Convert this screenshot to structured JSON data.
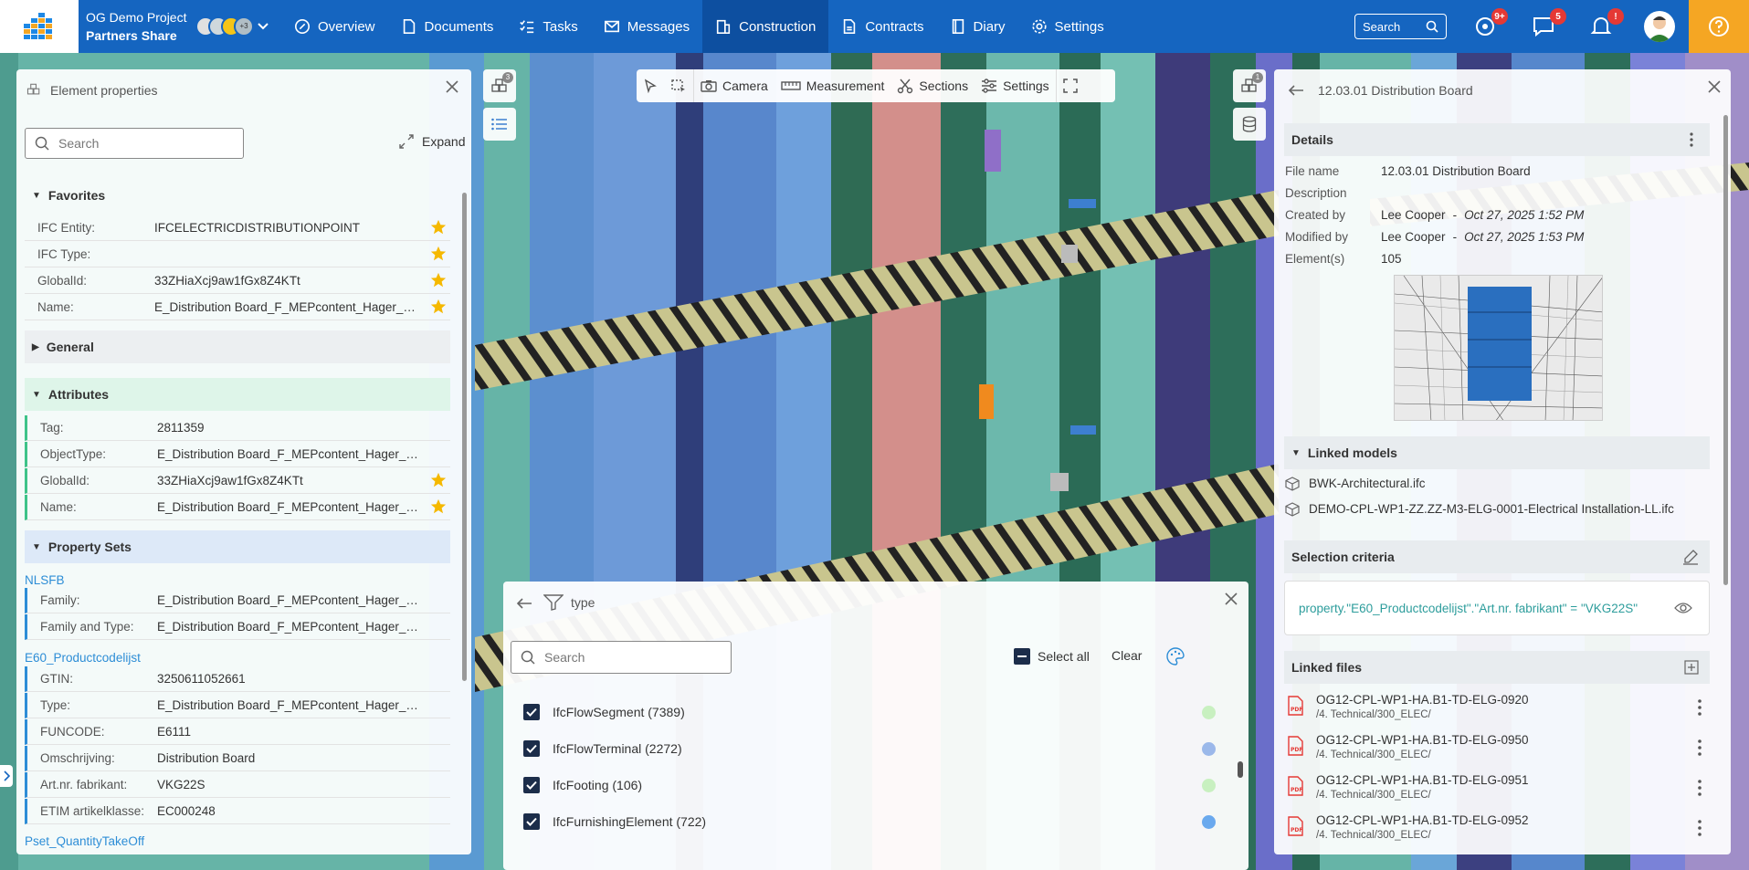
{
  "app": {
    "project_name": "OG Demo Project",
    "company": "Partners Share",
    "avatar_extra": "+3"
  },
  "nav": [
    {
      "label": "Overview",
      "icon": "overview-icon"
    },
    {
      "label": "Documents",
      "icon": "document-icon"
    },
    {
      "label": "Tasks",
      "icon": "tasks-icon"
    },
    {
      "label": "Messages",
      "icon": "mail-icon"
    },
    {
      "label": "Construction",
      "icon": "building-icon",
      "active": true
    },
    {
      "label": "Contracts",
      "icon": "contract-icon"
    },
    {
      "label": "Diary",
      "icon": "diary-icon"
    },
    {
      "label": "Settings",
      "icon": "gear-icon"
    }
  ],
  "topright": {
    "search_label": "Search",
    "badge_activity": "9+",
    "badge_chat": "5",
    "badge_alert": "!",
    "colors": {
      "brand": "#1565c0",
      "help": "#f5a623",
      "badge": "#e53935"
    }
  },
  "toolbar": {
    "camera": "Camera",
    "measurement": "Measurement",
    "sections": "Sections",
    "settings": "Settings",
    "models_count": "3",
    "right_models_count": "1"
  },
  "left_panel": {
    "title": "Element properties",
    "search_placeholder": "Search",
    "expand_label": "Expand",
    "favorites": {
      "title": "Favorites",
      "rows": [
        {
          "key": "IFC Entity:",
          "value": "IFCELECTRICDISTRIBUTIONPOINT"
        },
        {
          "key": "IFC Type:",
          "value": ""
        },
        {
          "key": "GlobalId:",
          "value": "33ZHiaXcj9aw1fGx8Z4KTt"
        },
        {
          "key": "Name:",
          "value": "E_Distribution Board_F_MEPcontent_Hager_…"
        }
      ]
    },
    "general": {
      "title": "General"
    },
    "attributes": {
      "title": "Attributes",
      "rows": [
        {
          "key": "Tag:",
          "value": "2811359"
        },
        {
          "key": "ObjectType:",
          "value": "E_Distribution Board_F_MEPcontent_Hager_…"
        },
        {
          "key": "GlobalId:",
          "value": "33ZHiaXcj9aw1fGx8Z4KTt"
        },
        {
          "key": "Name:",
          "value": "E_Distribution Board_F_MEPcontent_Hager_…"
        }
      ]
    },
    "property_sets": {
      "title": "Property Sets",
      "nlsfb": {
        "title": "NLSFB",
        "rows": [
          {
            "key": "Family:",
            "value": "E_Distribution Board_F_MEPcontent_Hager_…"
          },
          {
            "key": "Family and Type:",
            "value": "E_Distribution Board_F_MEPcontent_Hager_…"
          }
        ]
      },
      "e60": {
        "title": "E60_Productcodelijst",
        "rows": [
          {
            "key": "GTIN:",
            "value": "3250611052661"
          },
          {
            "key": "Type:",
            "value": "E_Distribution Board_F_MEPcontent_Hager_…"
          },
          {
            "key": "FUNCODE:",
            "value": "E6111"
          },
          {
            "key": "Omschrijving:",
            "value": "Distribution Board"
          },
          {
            "key": "Art.nr. fabrikant:",
            "value": "VKG22S"
          },
          {
            "key": "ETIM artikelklasse:",
            "value": "EC000248"
          }
        ]
      },
      "pset_qto": {
        "title": "Pset_QuantityTakeOff"
      }
    }
  },
  "right_panel": {
    "title": "12.03.01 Distribution Board",
    "details": {
      "title": "Details",
      "file_name_label": "File name",
      "file_name": "12.03.01 Distribution Board",
      "description_label": "Description",
      "created_by_label": "Created by",
      "created_by": "Lee Cooper",
      "created_at": "Oct 27, 2025 1:52 PM",
      "modified_by_label": "Modified by",
      "modified_by": "Lee Cooper",
      "modified_at": "Oct 27, 2025 1:53 PM",
      "elements_label": "Element(s)",
      "elements": "105",
      "separator": "-"
    },
    "linked_models": {
      "title": "Linked models",
      "items": [
        "BWK-Architectural.ifc",
        "DEMO-CPL-WP1-ZZ.ZZ-M3-ELG-0001-Electrical Installation-LL.ifc"
      ]
    },
    "selection_criteria": {
      "title": "Selection criteria",
      "text": "property.\"E60_Productcodelijst\".\"Art.nr. fabrikant\" = \"VKG22S\""
    },
    "linked_files": {
      "title": "Linked files",
      "items": [
        {
          "name": "OG12-CPL-WP1-HA.B1-TD-ELG-0920",
          "path": "/4. Technical/300_ELEC/"
        },
        {
          "name": "OG12-CPL-WP1-HA.B1-TD-ELG-0950",
          "path": "/4. Technical/300_ELEC/"
        },
        {
          "name": "OG12-CPL-WP1-HA.B1-TD-ELG-0951",
          "path": "/4. Technical/300_ELEC/"
        },
        {
          "name": "OG12-CPL-WP1-HA.B1-TD-ELG-0952",
          "path": "/4. Technical/300_ELEC/"
        }
      ]
    }
  },
  "filter_panel": {
    "title": "type",
    "search_placeholder": "Search",
    "select_all": "Select all",
    "clear": "Clear",
    "items": [
      {
        "label": "IfcFlowSegment (7389)",
        "checked": true,
        "color": "#c8f0c0"
      },
      {
        "label": "IfcFlowTerminal (2272)",
        "checked": true,
        "color": "#9bb8ea"
      },
      {
        "label": "IfcFooting (106)",
        "checked": true,
        "color": "#c8f0c0"
      },
      {
        "label": "IfcFurnishingElement (722)",
        "checked": true,
        "color": "#6aa9ee"
      }
    ]
  }
}
